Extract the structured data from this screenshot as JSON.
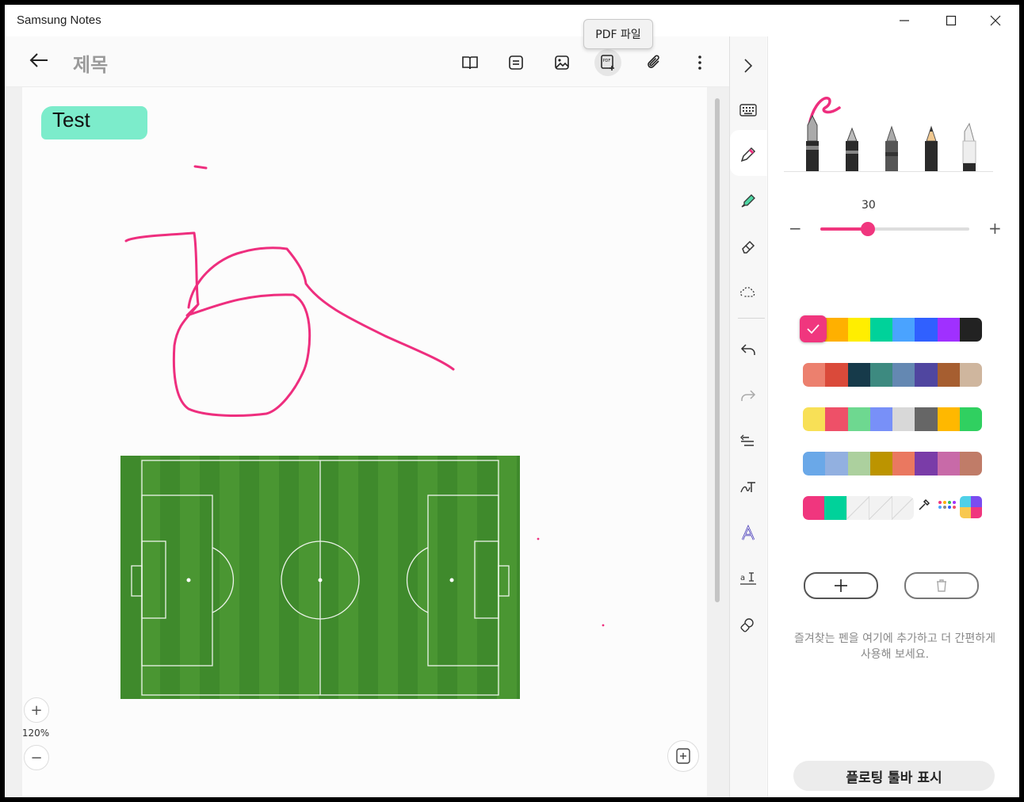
{
  "window": {
    "title": "Samsung Notes"
  },
  "toolbar": {
    "doc_title": "제목",
    "tooltip": "PDF 파일"
  },
  "note": {
    "text": "Test"
  },
  "zoom": {
    "level": "120%"
  },
  "pen_panel": {
    "size": "30",
    "size_min": 0,
    "size_max": 100,
    "size_fraction": 0.32,
    "selected_color": "#f0367e",
    "palette": [
      [
        "#f0367e",
        "#ffb000",
        "#ffee00",
        "#00d29a",
        "#4aa3ff",
        "#3060ff",
        "#a030ff",
        "#222222"
      ],
      [
        "#ec806e",
        "#da4a3a",
        "#163a4a",
        "#3d8a80",
        "#6488b2",
        "#5046a0",
        "#a65e30",
        "#cfb69e"
      ],
      [
        "#f8e056",
        "#ee5068",
        "#6ed890",
        "#7890f8",
        "#d8d8d8",
        "#666666",
        "#ffb800",
        "#30d060"
      ],
      [
        "#6aa8e8",
        "#92b0e0",
        "#acd09e",
        "#bc9400",
        "#ea7860",
        "#7a3ca8",
        "#c86aa8",
        "#c07c68"
      ],
      [
        "#f0367e",
        "#00d29a",
        "#eeeeee",
        "#eeeeee",
        "#eeeeee",
        "#ffffff",
        "#ffffff",
        "#ffffff"
      ]
    ],
    "hint": "즐겨찾는 펜을 여기에 추가하고 더 간편하게 사용해 보세요.",
    "floating_toolbar": "플로팅 툴바 표시"
  }
}
